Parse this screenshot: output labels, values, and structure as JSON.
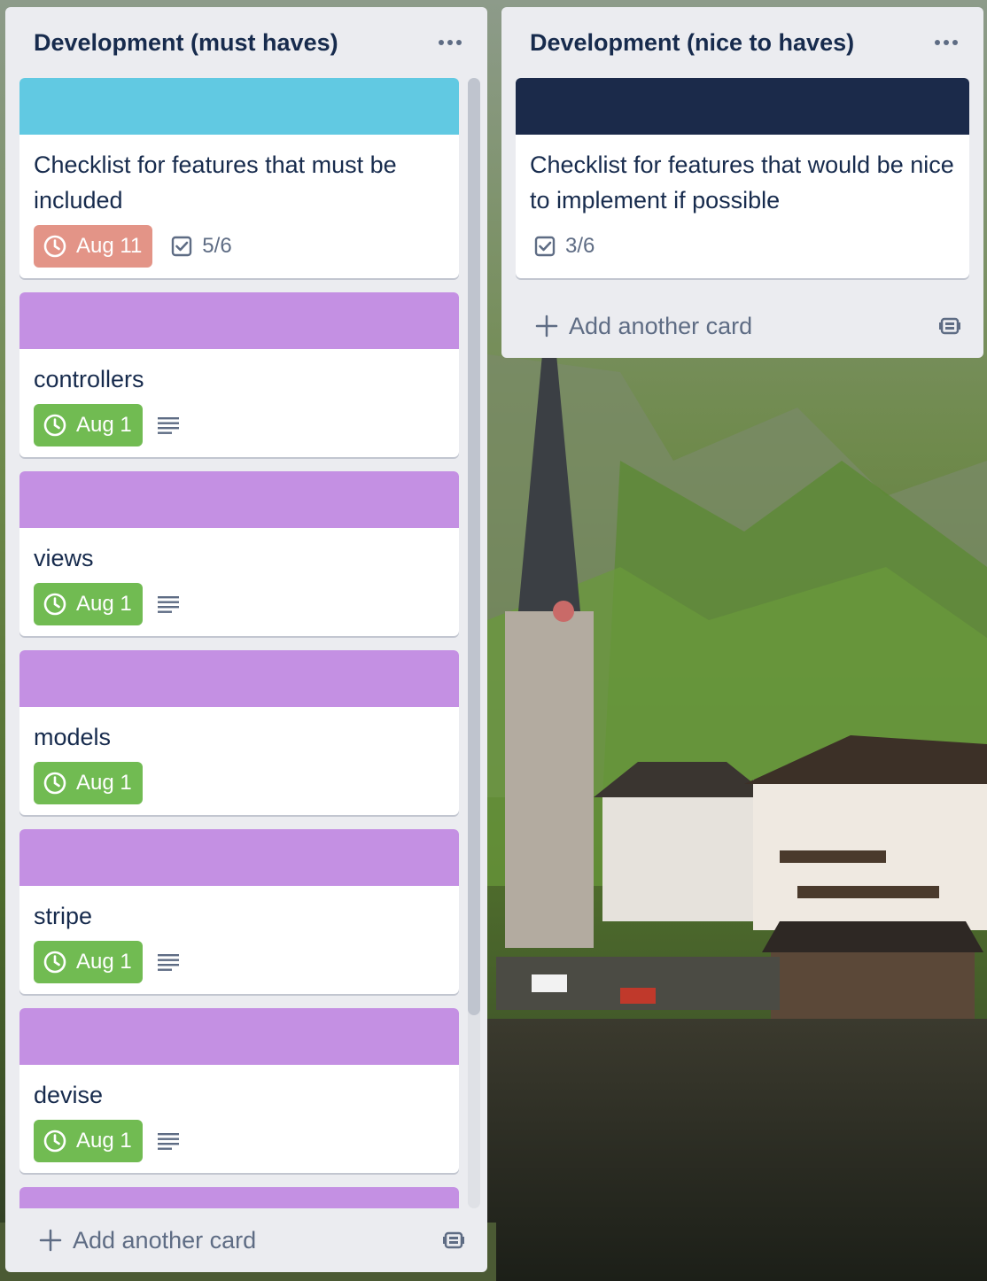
{
  "colors": {
    "list_bg": "#ebecf0",
    "title_text": "#172b4d",
    "muted_text": "#5e6c84",
    "cover_sky": "#61c9e2",
    "cover_navy": "#1b2a4a",
    "cover_purple": "#c490e3",
    "due_overdue": "#e39487",
    "due_complete": "#71bb52"
  },
  "lists": [
    {
      "title": "Development (must haves)",
      "menu_icon": "more-horizontal-icon",
      "add_card_label": "Add another card",
      "template_icon": "card-template-icon",
      "cards": [
        {
          "cover": "#61c9e2",
          "title": "Checklist for features that must be included",
          "due": "Aug 11",
          "due_status": "overdue",
          "checklist": "5/6",
          "has_description": false
        },
        {
          "cover": "#c490e3",
          "title": "controllers",
          "due": "Aug 1",
          "due_status": "complete",
          "checklist": "",
          "has_description": true
        },
        {
          "cover": "#c490e3",
          "title": "views",
          "due": "Aug 1",
          "due_status": "complete",
          "checklist": "",
          "has_description": true
        },
        {
          "cover": "#c490e3",
          "title": "models",
          "due": "Aug 1",
          "due_status": "complete",
          "checklist": "",
          "has_description": false
        },
        {
          "cover": "#c490e3",
          "title": "stripe",
          "due": "Aug 1",
          "due_status": "complete",
          "checklist": "",
          "has_description": true
        },
        {
          "cover": "#c490e3",
          "title": "devise",
          "due": "Aug 1",
          "due_status": "complete",
          "checklist": "",
          "has_description": true
        },
        {
          "cover": "#c490e3",
          "title": "",
          "due": "",
          "due_status": "",
          "checklist": "",
          "has_description": false
        }
      ]
    },
    {
      "title": "Development (nice to haves)",
      "menu_icon": "more-horizontal-icon",
      "add_card_label": "Add another card",
      "template_icon": "card-template-icon",
      "cards": [
        {
          "cover": "#1b2a4a",
          "title": "Checklist for features that would be nice to implement if possible",
          "due": "",
          "due_status": "",
          "checklist": "3/6",
          "has_description": false
        }
      ]
    }
  ]
}
